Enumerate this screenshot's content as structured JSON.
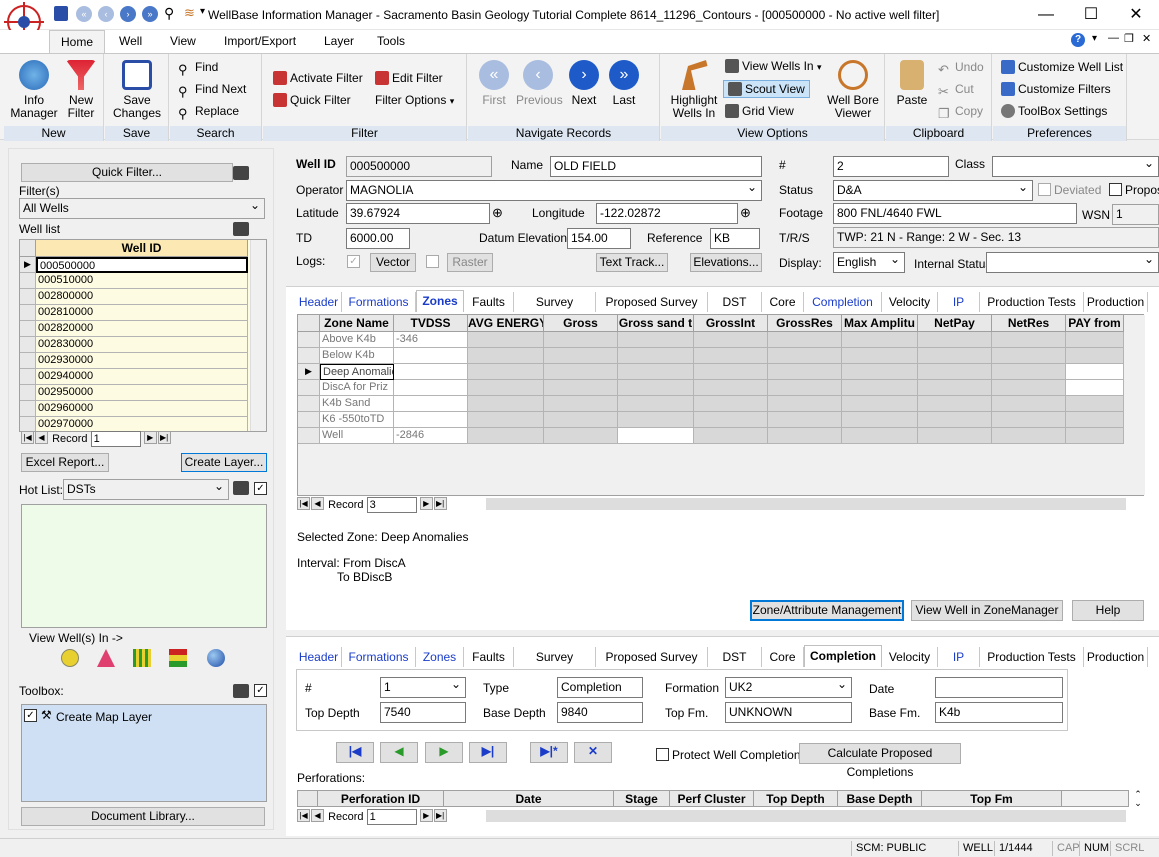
{
  "window": {
    "title": "WellBase Information Manager - Sacramento Basin Geology Tutorial Complete 8614_11296_Contours - [000500000 - No active well filter]"
  },
  "menu": [
    "Home",
    "Well",
    "View",
    "Import/Export",
    "Layer",
    "Tools"
  ],
  "ribbon": {
    "new": {
      "label": "New",
      "info_manager": "Info\nManager",
      "new_filter": "New\nFilter"
    },
    "save": {
      "label": "Save",
      "save_changes": "Save\nChanges"
    },
    "search": {
      "label": "Search",
      "find": "Find",
      "find_next": "Find Next",
      "replace": "Replace"
    },
    "filter": {
      "label": "Filter",
      "activate": "Activate Filter",
      "quick": "Quick Filter",
      "edit": "Edit Filter",
      "options": "Filter Options"
    },
    "navigate": {
      "label": "Navigate Records",
      "first": "First",
      "previous": "Previous",
      "next": "Next",
      "last": "Last"
    },
    "view": {
      "label": "View Options",
      "highlight": "Highlight\nWells In",
      "view_wells_in": "View Wells In",
      "scout": "Scout View",
      "grid": "Grid View",
      "wellbore": "Well Bore\nViewer"
    },
    "clipboard": {
      "label": "Clipboard",
      "paste": "Paste",
      "undo": "Undo",
      "cut": "Cut",
      "copy": "Copy"
    },
    "prefs": {
      "label": "Preferences",
      "cust_list": "Customize Well List",
      "cust_filters": "Customize Filters",
      "toolbox": "ToolBox Settings"
    }
  },
  "left": {
    "quick_filter": "Quick Filter...",
    "filters_label": "Filter(s)",
    "filter_value": "All Wells",
    "well_list_label": "Well list",
    "well_id_header": "Well ID",
    "wells": [
      "000500000",
      "000510000",
      "002800000",
      "002810000",
      "002820000",
      "002830000",
      "002930000",
      "002940000",
      "002950000",
      "002960000",
      "002970000"
    ],
    "record_label": "Record",
    "record_value": "1",
    "excel": "Excel Report...",
    "create_layer": "Create Layer...",
    "hot_list_label": "Hot List:",
    "hot_list_value": "DSTs",
    "view_wells_in": "View Well(s) In ->",
    "toolbox_label": "Toolbox:",
    "toolbox_item": "Create Map Layer",
    "doc_lib": "Document Library..."
  },
  "header": {
    "well_id_label": "Well ID",
    "well_id": "000500000",
    "name_label": "Name",
    "name": "OLD FIELD",
    "hash_label": "#",
    "hash": "2",
    "class_label": "Class",
    "class": "",
    "operator_label": "Operator",
    "operator": "MAGNOLIA",
    "status_label": "Status",
    "status": "D&A",
    "deviated": "Deviated",
    "proposed": "Propose",
    "lat_label": "Latitude",
    "lat": "39.67924",
    "lon_label": "Longitude",
    "lon": "-122.02872",
    "footage_label": "Footage",
    "footage": "800 FNL/4640 FWL",
    "wsn_label": "WSN",
    "wsn": "1",
    "td_label": "TD",
    "td": "6000.00",
    "datum_label": "Datum Elevation",
    "datum": "154.00",
    "ref_label": "Reference",
    "ref": "KB",
    "trs_label": "T/R/S",
    "trs": "TWP: 21  N - Range: 2  W - Sec. 13",
    "logs_label": "Logs:",
    "vector": "Vector",
    "raster": "Raster",
    "text_track": "Text Track...",
    "elevations": "Elevations...",
    "display_label": "Display:",
    "display": "English",
    "internal_label": "Internal Status",
    "internal": ""
  },
  "tabs1": [
    "Header",
    "Formations",
    "Zones",
    "Faults",
    "Survey",
    "Proposed Survey",
    "DST",
    "Core",
    "Completion",
    "Velocity",
    "IP",
    "Production Tests",
    "Production"
  ],
  "zones": {
    "columns": [
      "Zone Name",
      "TVDSS",
      "AVG ENERGY",
      "Gross",
      "Gross sand t",
      "GrossInt",
      "GrossRes",
      "Max Amplitu",
      "NetPay",
      "NetRes",
      "PAY from"
    ],
    "rows": [
      [
        "Above K4b",
        "-346"
      ],
      [
        "Below K4b",
        ""
      ],
      [
        "Deep Anomalie",
        ""
      ],
      [
        "DiscA for Priz",
        ""
      ],
      [
        "K4b Sand",
        ""
      ],
      [
        "K6 -550toTD",
        ""
      ],
      [
        "Well",
        "-2846"
      ]
    ],
    "record_label": "Record",
    "record": "3",
    "selected": "Selected Zone: Deep Anomalies",
    "interval": "Interval: From DiscA",
    "interval_to": "To BDiscB",
    "zam": "Zone/Attribute Management",
    "zm": "View Well in ZoneManager",
    "help": "Help"
  },
  "tabs2": [
    "Header",
    "Formations",
    "Zones",
    "Faults",
    "Survey",
    "Proposed Survey",
    "DST",
    "Core",
    "Completion",
    "Velocity",
    "IP",
    "Production Tests",
    "Production"
  ],
  "completion": {
    "hash_label": "#",
    "hash": "1",
    "type_label": "Type",
    "type": "Completion",
    "formation_label": "Formation",
    "formation": "UK2",
    "date_label": "Date",
    "date": "",
    "top_label": "Top Depth",
    "top": "7540",
    "base_label": "Base Depth",
    "base": "9840",
    "topfm_label": "Top Fm.",
    "topfm": "UNKNOWN",
    "basefm_label": "Base Fm.",
    "basefm": "K4b",
    "protect": "Protect Well Completion",
    "calc": "Calculate Proposed Completions",
    "perf_label": "Perforations:",
    "perf_cols": [
      "Perforation ID",
      "Date",
      "Stage",
      "Perf Cluster",
      "Top Depth",
      "Base Depth",
      "Top Fm"
    ],
    "record_label": "Record",
    "record": "1"
  },
  "status": {
    "scm": "SCM: PUBLIC",
    "well": "WELL",
    "count": "1/1444",
    "cap": "CAP",
    "num": "NUM",
    "scrl": "SCRL"
  }
}
